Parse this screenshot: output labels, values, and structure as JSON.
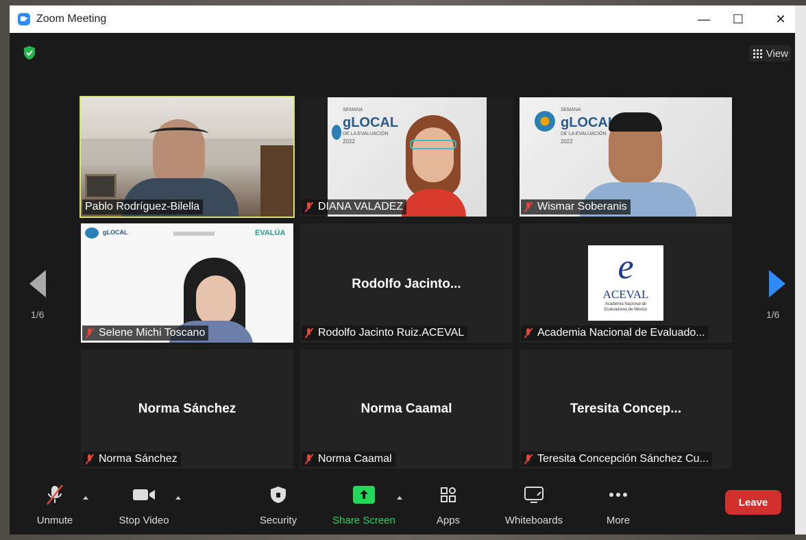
{
  "window": {
    "title": "Zoom Meeting",
    "minimize": "—",
    "maximize": "☐",
    "close": "✕"
  },
  "view": {
    "label": "View"
  },
  "pagination": {
    "left": "1/6",
    "right": "1/6"
  },
  "tiles": [
    {
      "name": "Pablo Rodríguez-Bilella",
      "muted": false,
      "active": true,
      "big": ""
    },
    {
      "name": "DIANA VALADEZ",
      "muted": true,
      "active": false,
      "big": ""
    },
    {
      "name": "Wismar Soberanis",
      "muted": true,
      "active": false,
      "big": ""
    },
    {
      "name": "Selene Michi Toscano",
      "muted": true,
      "active": false,
      "big": ""
    },
    {
      "name": "Rodolfo Jacinto Ruiz.ACEVAL",
      "muted": true,
      "active": false,
      "big": "Rodolfo  Jacinto..."
    },
    {
      "name": "Academia Nacional de Evaluado...",
      "muted": true,
      "active": false,
      "big": ""
    },
    {
      "name": "Norma Sánchez",
      "muted": true,
      "active": false,
      "big": "Norma Sánchez"
    },
    {
      "name": "Norma Caamal",
      "muted": true,
      "active": false,
      "big": "Norma Caamal"
    },
    {
      "name": "Teresita Concepción Sánchez Cu...",
      "muted": true,
      "active": false,
      "big": "Teresita  Concep..."
    }
  ],
  "glocal": {
    "word": "gLOCAL",
    "sub": "DE LA EVALUACIÓN",
    "year": "2022",
    "semana": "SEMANA"
  },
  "aceval": {
    "letter": "e",
    "name": "ACEVAL",
    "sub": "Academia Nacional de Evaluadores de México"
  },
  "evalua": "EVALÚA",
  "toolbar": {
    "unmute": "Unmute",
    "stop_video": "Stop Video",
    "security": "Security",
    "share_screen": "Share Screen",
    "apps": "Apps",
    "whiteboards": "Whiteboards",
    "more": "More",
    "leave": "Leave"
  },
  "colors": {
    "accent": "#2d8cff",
    "share": "#23d959",
    "leave": "#d32f2f",
    "active_border": "#d7e56b",
    "muted": "#e0473c"
  }
}
